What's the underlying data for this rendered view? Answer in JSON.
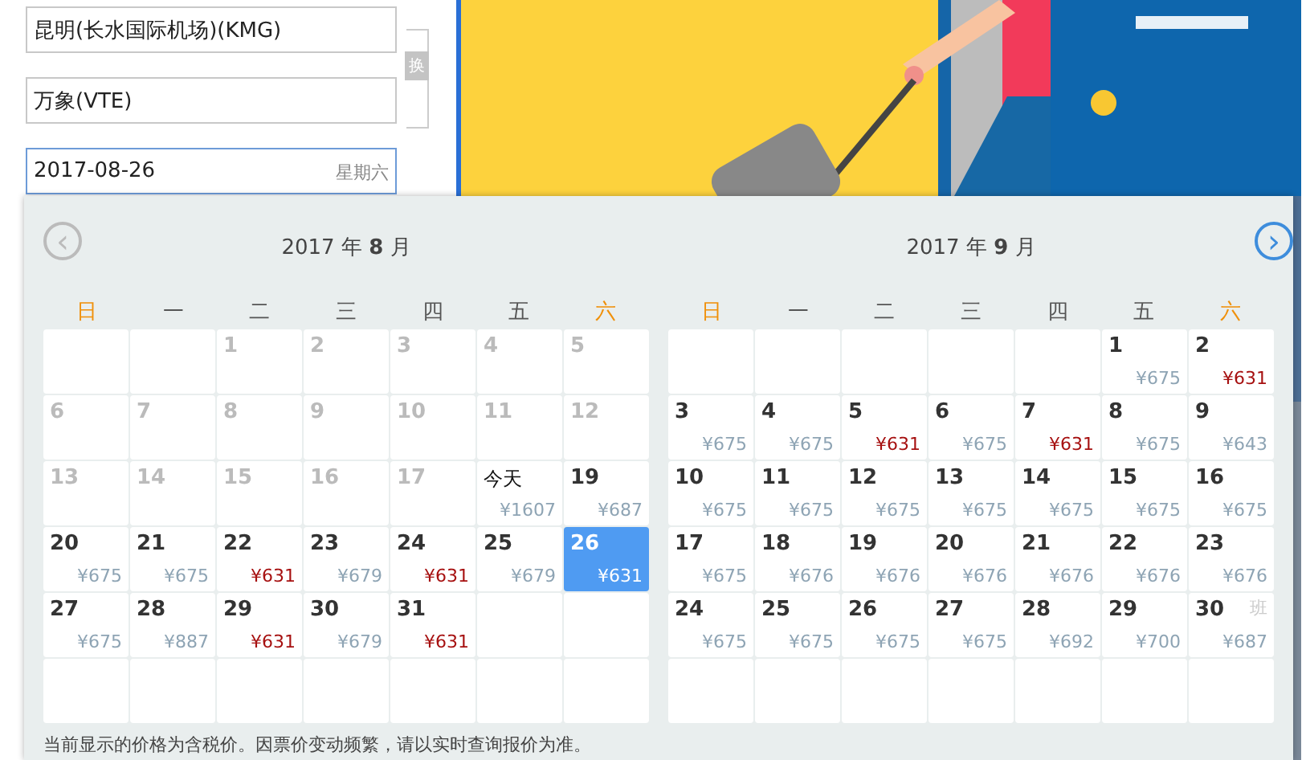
{
  "form": {
    "fields": [
      {
        "value": "昆明(长水国际机场)(KMG)",
        "focused": false
      },
      {
        "value": "万象(VTE)",
        "focused": false
      },
      {
        "value": "2017-08-26",
        "hint": "星期六",
        "focused": true
      }
    ],
    "swap_button": "换"
  },
  "calendar": {
    "prev": {
      "label": "‹",
      "disabled": true
    },
    "next": {
      "label": "›",
      "disabled": false
    },
    "months": [
      {
        "title": "2017 年 **8** 月",
        "weekdays": [
          {
            "label": "日",
            "weekend": true
          },
          {
            "label": "一",
            "weekend": false
          },
          {
            "label": "二",
            "weekend": false
          },
          {
            "label": "三",
            "weekend": false
          },
          {
            "label": "四",
            "weekend": false
          },
          {
            "label": "五",
            "weekend": false
          },
          {
            "label": "六",
            "weekend": true
          }
        ],
        "days": [
          {
            "kind": "blank"
          },
          {
            "kind": "blank"
          },
          {
            "kind": "past",
            "label": "1"
          },
          {
            "kind": "past",
            "label": "2"
          },
          {
            "kind": "past",
            "label": "3"
          },
          {
            "kind": "past",
            "label": "4"
          },
          {
            "kind": "past",
            "label": "5"
          },
          {
            "kind": "past",
            "label": "6"
          },
          {
            "kind": "past",
            "label": "7"
          },
          {
            "kind": "past",
            "label": "8"
          },
          {
            "kind": "past",
            "label": "9"
          },
          {
            "kind": "past",
            "label": "10"
          },
          {
            "kind": "past",
            "label": "11"
          },
          {
            "kind": "past",
            "label": "12"
          },
          {
            "kind": "past",
            "label": "13"
          },
          {
            "kind": "past",
            "label": "14"
          },
          {
            "kind": "past",
            "label": "15"
          },
          {
            "kind": "past",
            "label": "16"
          },
          {
            "kind": "past",
            "label": "17"
          },
          {
            "kind": "today",
            "label": "今天",
            "price": "¥1607",
            "lowest": false,
            "selected": false
          },
          {
            "kind": "day",
            "label": "19",
            "price": "¥687",
            "lowest": false,
            "selected": false
          },
          {
            "kind": "day",
            "label": "20",
            "price": "¥675",
            "lowest": false,
            "selected": false
          },
          {
            "kind": "day",
            "label": "21",
            "price": "¥675",
            "lowest": false,
            "selected": false
          },
          {
            "kind": "day",
            "label": "22",
            "price": "¥631",
            "lowest": true,
            "selected": false
          },
          {
            "kind": "day",
            "label": "23",
            "price": "¥679",
            "lowest": false,
            "selected": false
          },
          {
            "kind": "day",
            "label": "24",
            "price": "¥631",
            "lowest": true,
            "selected": false
          },
          {
            "kind": "day",
            "label": "25",
            "price": "¥679",
            "lowest": false,
            "selected": false
          },
          {
            "kind": "day",
            "label": "26",
            "price": "¥631",
            "lowest": true,
            "selected": true
          },
          {
            "kind": "day",
            "label": "27",
            "price": "¥675",
            "lowest": false,
            "selected": false
          },
          {
            "kind": "day",
            "label": "28",
            "price": "¥887",
            "lowest": false,
            "selected": false
          },
          {
            "kind": "day",
            "label": "29",
            "price": "¥631",
            "lowest": true,
            "selected": false
          },
          {
            "kind": "day",
            "label": "30",
            "price": "¥679",
            "lowest": false,
            "selected": false
          },
          {
            "kind": "day",
            "label": "31",
            "price": "¥631",
            "lowest": true,
            "selected": false
          }
        ]
      },
      {
        "title": "2017 年 **9** 月",
        "weekdays": [
          {
            "label": "日",
            "weekend": true
          },
          {
            "label": "一",
            "weekend": false
          },
          {
            "label": "二",
            "weekend": false
          },
          {
            "label": "三",
            "weekend": false
          },
          {
            "label": "四",
            "weekend": false
          },
          {
            "label": "五",
            "weekend": false
          },
          {
            "label": "六",
            "weekend": true
          }
        ],
        "days": [
          {
            "kind": "blank"
          },
          {
            "kind": "blank"
          },
          {
            "kind": "blank"
          },
          {
            "kind": "blank"
          },
          {
            "kind": "blank"
          },
          {
            "kind": "day",
            "label": "1",
            "price": "¥675",
            "lowest": false,
            "selected": false
          },
          {
            "kind": "day",
            "label": "2",
            "price": "¥631",
            "lowest": true,
            "selected": false
          },
          {
            "kind": "day",
            "label": "3",
            "price": "¥675",
            "lowest": false,
            "selected": false
          },
          {
            "kind": "day",
            "label": "4",
            "price": "¥675",
            "lowest": false,
            "selected": false
          },
          {
            "kind": "day",
            "label": "5",
            "price": "¥631",
            "lowest": true,
            "selected": false
          },
          {
            "kind": "day",
            "label": "6",
            "price": "¥675",
            "lowest": false,
            "selected": false
          },
          {
            "kind": "day",
            "label": "7",
            "price": "¥631",
            "lowest": true,
            "selected": false
          },
          {
            "kind": "day",
            "label": "8",
            "price": "¥675",
            "lowest": false,
            "selected": false
          },
          {
            "kind": "day",
            "label": "9",
            "price": "¥643",
            "lowest": false,
            "selected": false
          },
          {
            "kind": "day",
            "label": "10",
            "price": "¥675",
            "lowest": false,
            "selected": false
          },
          {
            "kind": "day",
            "label": "11",
            "price": "¥675",
            "lowest": false,
            "selected": false
          },
          {
            "kind": "day",
            "label": "12",
            "price": "¥675",
            "lowest": false,
            "selected": false
          },
          {
            "kind": "day",
            "label": "13",
            "price": "¥675",
            "lowest": false,
            "selected": false
          },
          {
            "kind": "day",
            "label": "14",
            "price": "¥675",
            "lowest": false,
            "selected": false
          },
          {
            "kind": "day",
            "label": "15",
            "price": "¥675",
            "lowest": false,
            "selected": false
          },
          {
            "kind": "day",
            "label": "16",
            "price": "¥675",
            "lowest": false,
            "selected": false
          },
          {
            "kind": "day",
            "label": "17",
            "price": "¥675",
            "lowest": false,
            "selected": false
          },
          {
            "kind": "day",
            "label": "18",
            "price": "¥676",
            "lowest": false,
            "selected": false
          },
          {
            "kind": "day",
            "label": "19",
            "price": "¥676",
            "lowest": false,
            "selected": false
          },
          {
            "kind": "day",
            "label": "20",
            "price": "¥676",
            "lowest": false,
            "selected": false
          },
          {
            "kind": "day",
            "label": "21",
            "price": "¥676",
            "lowest": false,
            "selected": false
          },
          {
            "kind": "day",
            "label": "22",
            "price": "¥676",
            "lowest": false,
            "selected": false
          },
          {
            "kind": "day",
            "label": "23",
            "price": "¥676",
            "lowest": false,
            "selected": false
          },
          {
            "kind": "day",
            "label": "24",
            "price": "¥675",
            "lowest": false,
            "selected": false
          },
          {
            "kind": "day",
            "label": "25",
            "price": "¥675",
            "lowest": false,
            "selected": false
          },
          {
            "kind": "day",
            "label": "26",
            "price": "¥675",
            "lowest": false,
            "selected": false
          },
          {
            "kind": "day",
            "label": "27",
            "price": "¥675",
            "lowest": false,
            "selected": false
          },
          {
            "kind": "day",
            "label": "28",
            "price": "¥692",
            "lowest": false,
            "selected": false
          },
          {
            "kind": "day",
            "label": "29",
            "price": "¥700",
            "lowest": false,
            "selected": false
          },
          {
            "kind": "day",
            "label": "30",
            "price": "¥687",
            "lowest": false,
            "selected": false,
            "tag": "班"
          }
        ]
      }
    ],
    "footnote": "当前显示的价格为含税价。因票价变动频繁，请以实时查询报价为准。"
  }
}
